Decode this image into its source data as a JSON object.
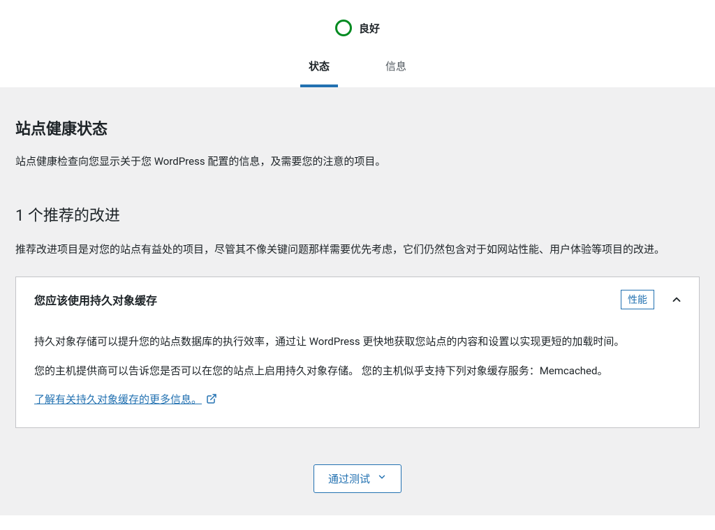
{
  "header": {
    "status_label": "良好",
    "tabs": [
      {
        "label": "状态",
        "active": true
      },
      {
        "label": "信息",
        "active": false
      }
    ]
  },
  "main": {
    "section_title": "站点健康状态",
    "section_description": "站点健康检查向您显示关于您 WordPress 配置的信息，及需要您的注意的项目。",
    "improvements_title": "1 个推荐的改进",
    "improvements_description": "推荐改进项目是对您的站点有益处的项目，尽管其不像关键问题那样需要优先考虑，它们仍然包含对于如网站性能、用户体验等项目的改进。",
    "issue": {
      "title": "您应该使用持久对象缓存",
      "badge": "性能",
      "paragraph1": "持久对象存储可以提升您的站点数据库的执行效率，通过让 WordPress 更快地获取您站点的内容和设置以实现更短的加载时间。",
      "paragraph2": "您的主机提供商可以告诉您是否可以在您的站点上启用持久对象存储。 您的主机似乎支持下列对象缓存服务：Memcached。",
      "link_text": "了解有关持久对象缓存的更多信息。"
    },
    "passed_button": "通过测试"
  }
}
